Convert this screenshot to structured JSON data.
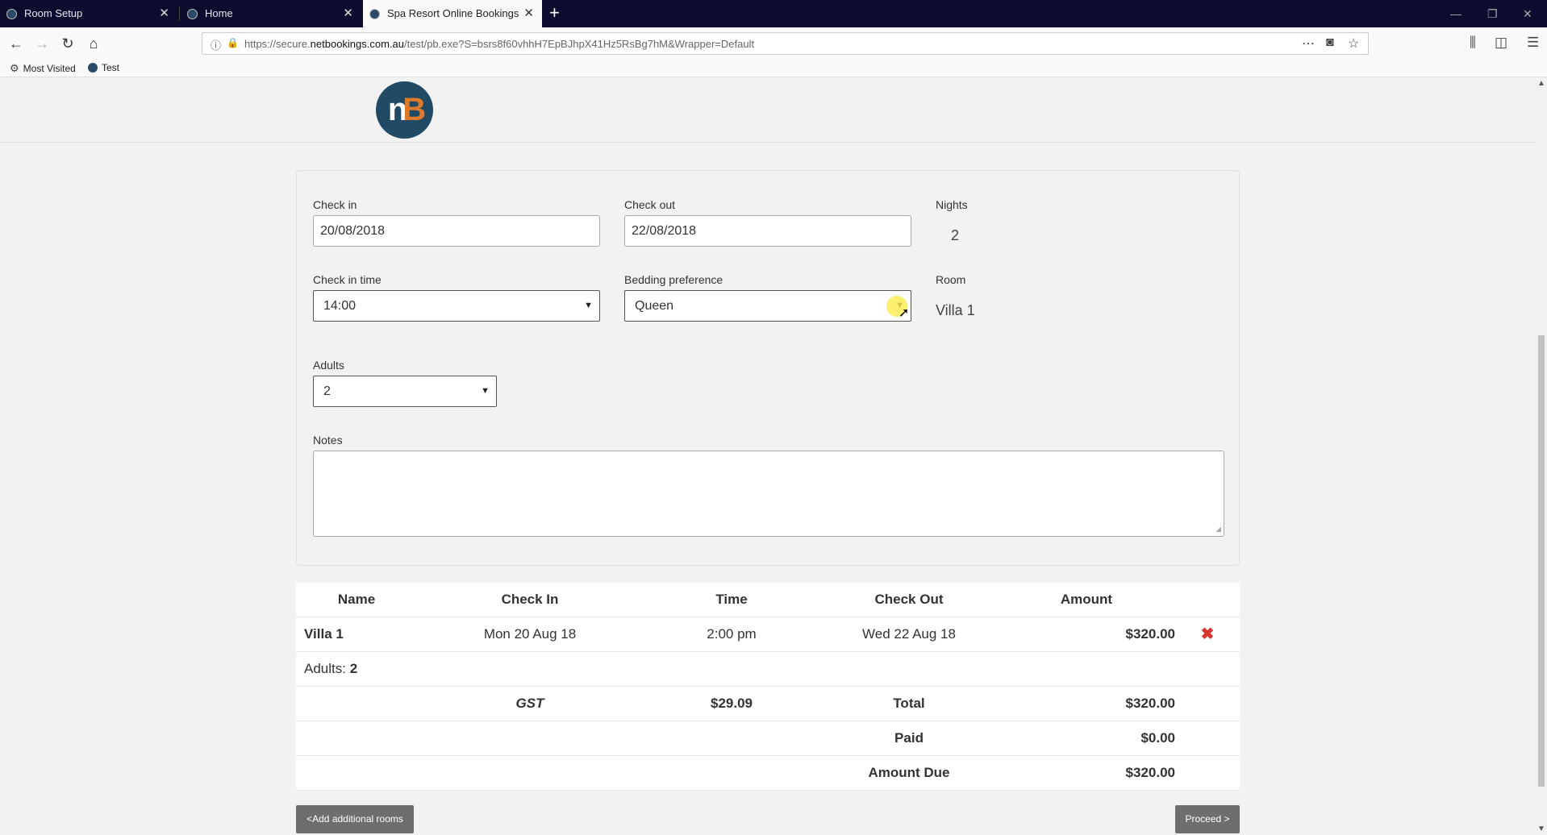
{
  "browser": {
    "tabs": [
      {
        "title": "Room Setup"
      },
      {
        "title": "Home"
      },
      {
        "title": "Spa Resort Online Bookings"
      }
    ],
    "url_prefix": "https://secure.",
    "url_domain": "netbookings.com.au",
    "url_rest": "/test/pb.exe?S=bsrs8f60vhhH7EpBJhpX41Hz5RsBg7hM&Wrapper=Default",
    "bookmarks": [
      {
        "label": "Most Visited"
      },
      {
        "label": "Test"
      }
    ]
  },
  "logo": {
    "n": "n",
    "b": "B"
  },
  "form": {
    "check_in_label": "Check in",
    "check_in_value": "20/08/2018",
    "check_out_label": "Check out",
    "check_out_value": "22/08/2018",
    "nights_label": "Nights",
    "nights_value": "2",
    "check_in_time_label": "Check in time",
    "check_in_time_value": "14:00",
    "bedding_label": "Bedding preference",
    "bedding_value": "Queen",
    "room_label": "Room",
    "room_value": "Villa 1",
    "adults_label": "Adults",
    "adults_value": "2",
    "notes_label": "Notes",
    "notes_value": ""
  },
  "summary": {
    "headers": [
      "Name",
      "Check In",
      "Time",
      "Check Out",
      "Amount"
    ],
    "row": {
      "name": "Villa 1",
      "check_in": "Mon 20 Aug 18",
      "time": "2:00 pm",
      "check_out": "Wed 22 Aug 18",
      "amount": "$320.00",
      "delete_symbol": "✖"
    },
    "adults_label": "Adults: ",
    "adults_value": "2",
    "gst_label": "GST",
    "gst_value": "$29.09",
    "total_label": "Total",
    "total_value": "$320.00",
    "paid_label": "Paid",
    "paid_value": "$0.00",
    "due_label": "Amount Due",
    "due_value": "$320.00"
  },
  "buttons": {
    "add_rooms": "<Add additional rooms",
    "proceed": "Proceed >"
  }
}
